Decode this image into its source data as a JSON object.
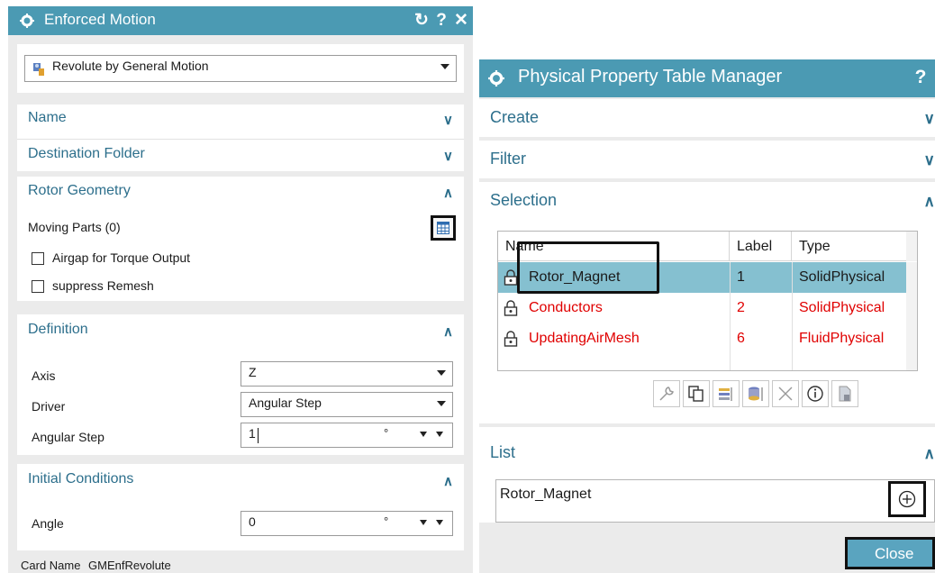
{
  "enforced_motion": {
    "title": "Enforced Motion",
    "type_selector": "Revolute by General Motion",
    "sections": {
      "name": "Name",
      "destination_folder": "Destination Folder",
      "rotor_geometry": "Rotor Geometry",
      "definition": "Definition",
      "initial_conditions": "Initial Conditions"
    },
    "moving_parts_label": "Moving Parts (0)",
    "airgap_label": "Airgap for Torque Output",
    "suppress_remesh_label": "suppress Remesh",
    "axis": {
      "label": "Axis",
      "value": "Z"
    },
    "driver": {
      "label": "Driver",
      "value": "Angular Step"
    },
    "angular_step": {
      "label": "Angular Step",
      "value": "1",
      "unit": "°"
    },
    "angle": {
      "label": "Angle",
      "value": "0",
      "unit": "°"
    },
    "card_name_label": "Card Name",
    "card_name_value": "GMEnfRevolute",
    "title_buttons": {
      "reset": "↻",
      "help": "?",
      "close": "✕"
    }
  },
  "ptm": {
    "title": "Physical Property Table Manager",
    "help_button": "?",
    "sections": {
      "create": "Create",
      "filter": "Filter",
      "selection": "Selection",
      "list": "List"
    },
    "columns": [
      "Name",
      "Label",
      "Type"
    ],
    "rows": [
      {
        "name": "Rotor_Magnet",
        "label": "1",
        "type": "SolidPhysical"
      },
      {
        "name": "Conductors",
        "label": "2",
        "type": "SolidPhysical"
      },
      {
        "name": "UpdatingAirMesh",
        "label": "6",
        "type": "FluidPhysical"
      }
    ],
    "list_value": "Rotor_Magnet",
    "close_button": "Close"
  },
  "colors": {
    "title_bar": "#4b9ab3",
    "section_title": "#2d6f8c",
    "selected_row": "#85c0d0",
    "error_red": "#e00000"
  }
}
